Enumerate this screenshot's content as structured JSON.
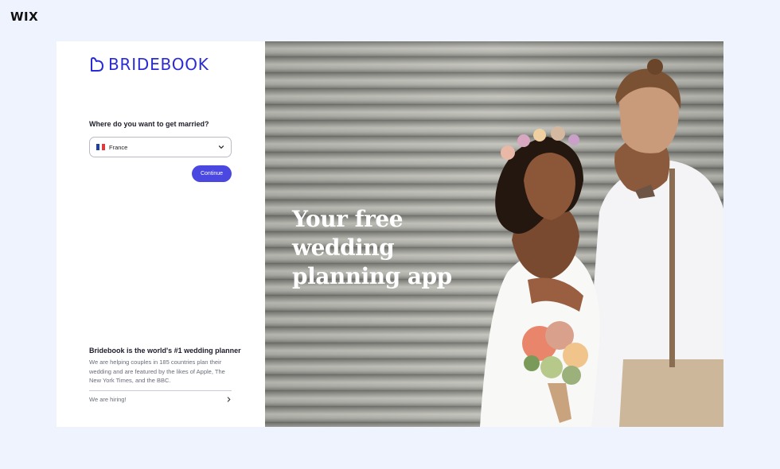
{
  "platform": {
    "logo_text": "WIX"
  },
  "brand": {
    "name": "BRIDEBOOK",
    "accent_color": "#2b2bd6"
  },
  "form": {
    "question": "Where do you want to get married?",
    "country_select": {
      "value": "France",
      "flag_icon": "france-flag-icon"
    },
    "continue_label": "Continue",
    "button_color": "#4a48e0"
  },
  "promo": {
    "title": "Bridebook is the world's #1 wedding planner",
    "text": "We are helping couples in 185 countries plan their wedding and are featured by the likes of Apple, The New York Times, and the BBC.",
    "hiring_label": "We are hiring!"
  },
  "hero": {
    "title_line1": "Your free wedding",
    "title_line2": "planning app"
  }
}
